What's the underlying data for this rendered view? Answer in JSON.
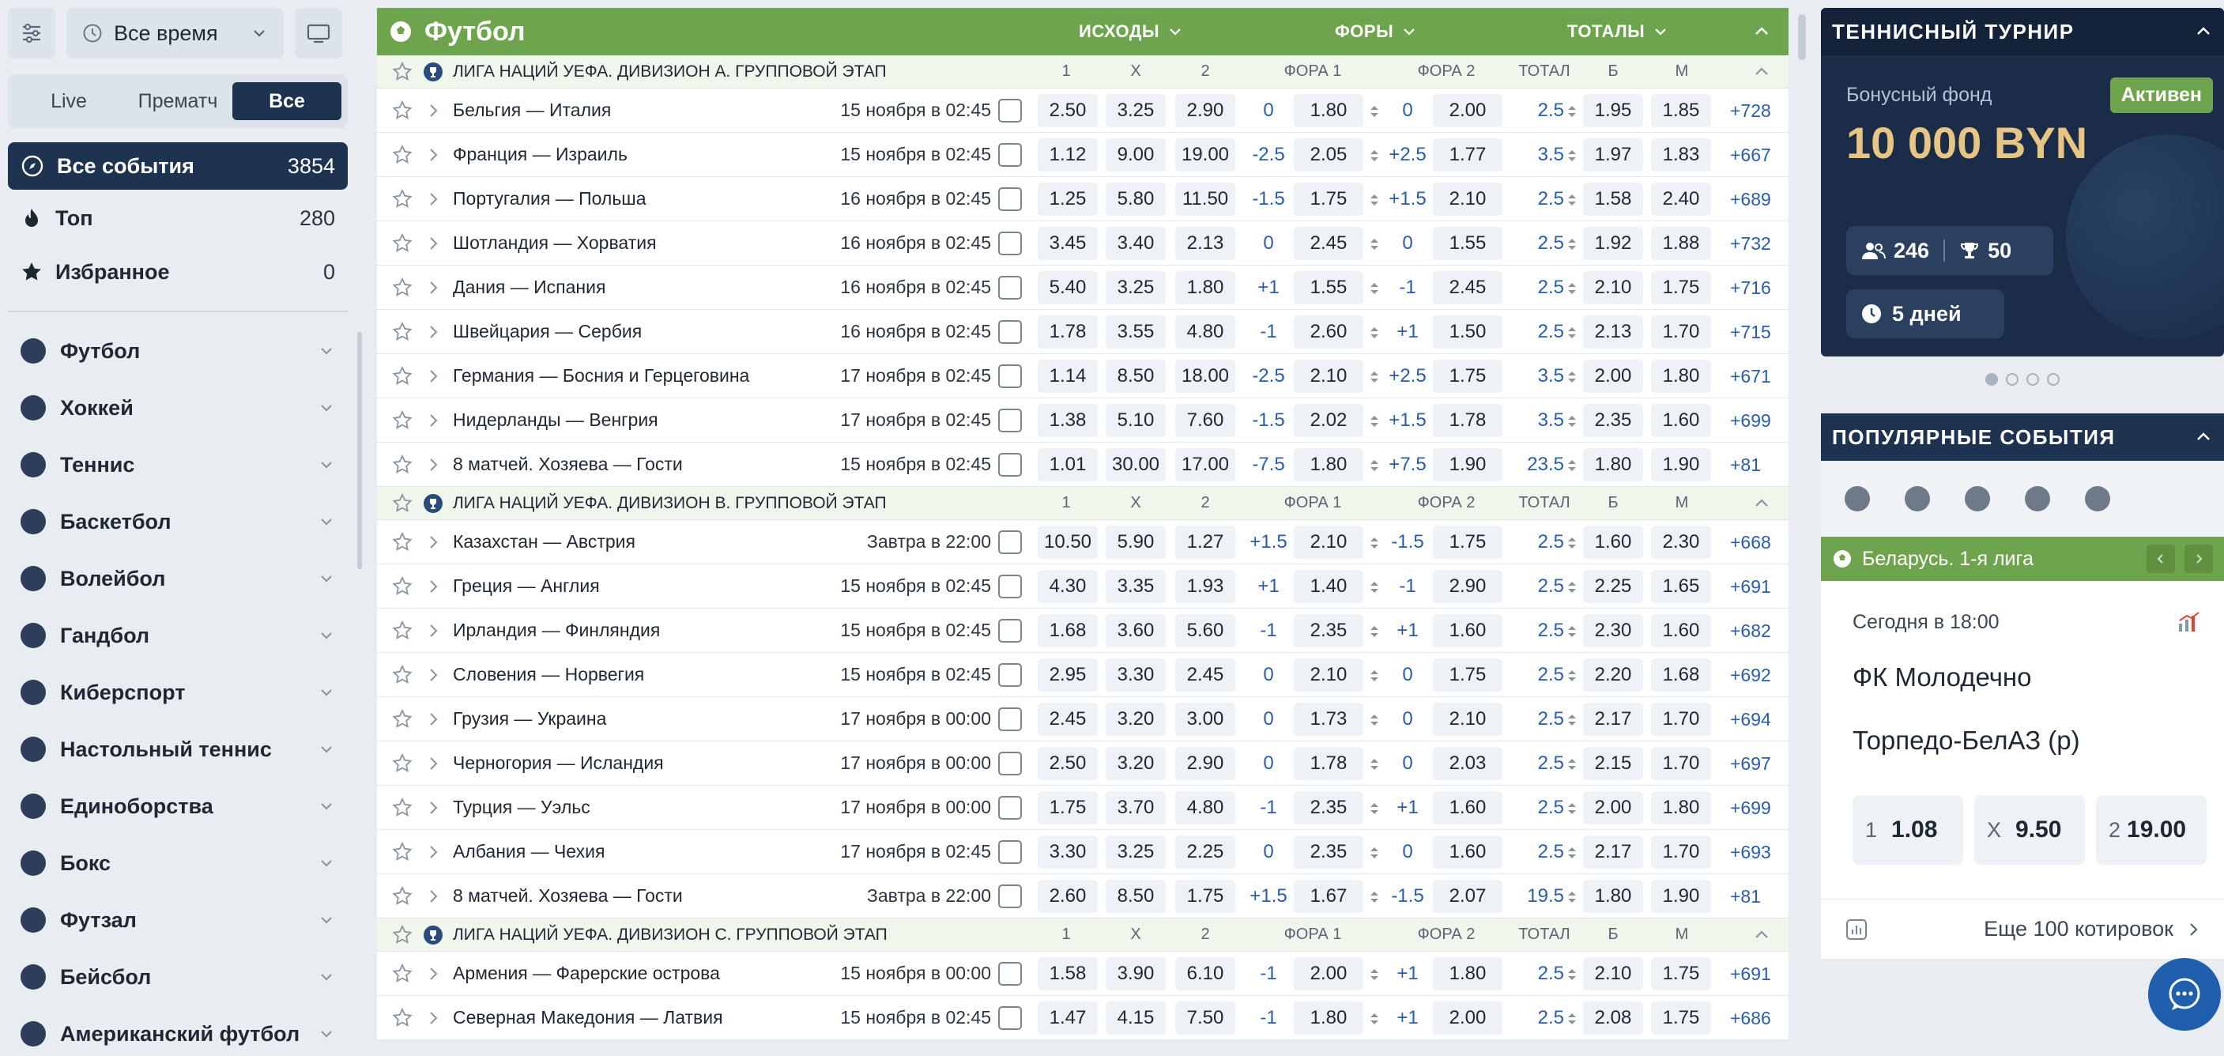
{
  "sidebar": {
    "time_filter": "Все время",
    "tabs": [
      "Live",
      "Прематч",
      "Все"
    ],
    "all_events": {
      "label": "Все события",
      "count": "3854"
    },
    "top": {
      "label": "Топ",
      "count": "280"
    },
    "favorites": {
      "label": "Избранное",
      "count": "0"
    },
    "sports": [
      "Футбол",
      "Хоккей",
      "Теннис",
      "Баскетбол",
      "Волейбол",
      "Гандбол",
      "Киберспорт",
      "Настольный теннис",
      "Единоборства",
      "Бокс",
      "Футзал",
      "Бейсбол",
      "Американский футбол"
    ]
  },
  "main": {
    "sport_title": "Футбол",
    "groups": [
      "ИСХОДЫ",
      "ФОРЫ",
      "ТОТАЛЫ"
    ],
    "columns": [
      "1",
      "X",
      "2",
      "ФОРА 1",
      "ФОРА 2",
      "ТОТАЛ",
      "Б",
      "М"
    ],
    "leagues": [
      {
        "name": "ЛИГА НАЦИЙ УЕФА. ДИВИЗИОН A. ГРУППОВОЙ ЭТАП",
        "events": [
          {
            "name": "Бельгия — Италия",
            "date": "15 ноября в 02:45",
            "o1": "2.50",
            "ox": "3.25",
            "o2": "2.90",
            "h1": "0",
            "h1o": "1.80",
            "h2": "0",
            "h2o": "2.00",
            "t": "2.5",
            "b": "1.95",
            "m": "1.85",
            "more": "+728"
          },
          {
            "name": "Франция — Израиль",
            "date": "15 ноября в 02:45",
            "o1": "1.12",
            "ox": "9.00",
            "o2": "19.00",
            "h1": "-2.5",
            "h1o": "2.05",
            "h2": "+2.5",
            "h2o": "1.77",
            "t": "3.5",
            "b": "1.97",
            "m": "1.83",
            "more": "+667"
          },
          {
            "name": "Португалия — Польша",
            "date": "16 ноября в 02:45",
            "o1": "1.25",
            "ox": "5.80",
            "o2": "11.50",
            "h1": "-1.5",
            "h1o": "1.75",
            "h2": "+1.5",
            "h2o": "2.10",
            "t": "2.5",
            "b": "1.58",
            "m": "2.40",
            "more": "+689"
          },
          {
            "name": "Шотландия — Хорватия",
            "date": "16 ноября в 02:45",
            "o1": "3.45",
            "ox": "3.40",
            "o2": "2.13",
            "h1": "0",
            "h1o": "2.45",
            "h2": "0",
            "h2o": "1.55",
            "t": "2.5",
            "b": "1.92",
            "m": "1.88",
            "more": "+732"
          },
          {
            "name": "Дания — Испания",
            "date": "16 ноября в 02:45",
            "o1": "5.40",
            "ox": "3.25",
            "o2": "1.80",
            "h1": "+1",
            "h1o": "1.55",
            "h2": "-1",
            "h2o": "2.45",
            "t": "2.5",
            "b": "2.10",
            "m": "1.75",
            "more": "+716"
          },
          {
            "name": "Швейцария — Сербия",
            "date": "16 ноября в 02:45",
            "o1": "1.78",
            "ox": "3.55",
            "o2": "4.80",
            "h1": "-1",
            "h1o": "2.60",
            "h2": "+1",
            "h2o": "1.50",
            "t": "2.5",
            "b": "2.13",
            "m": "1.70",
            "more": "+715"
          },
          {
            "name": "Германия — Босния и Герцеговина",
            "date": "17 ноября в 02:45",
            "o1": "1.14",
            "ox": "8.50",
            "o2": "18.00",
            "h1": "-2.5",
            "h1o": "2.10",
            "h2": "+2.5",
            "h2o": "1.75",
            "t": "3.5",
            "b": "2.00",
            "m": "1.80",
            "more": "+671"
          },
          {
            "name": "Нидерланды — Венгрия",
            "date": "17 ноября в 02:45",
            "o1": "1.38",
            "ox": "5.10",
            "o2": "7.60",
            "h1": "-1.5",
            "h1o": "2.02",
            "h2": "+1.5",
            "h2o": "1.78",
            "t": "3.5",
            "b": "2.35",
            "m": "1.60",
            "more": "+699"
          },
          {
            "name": "8 матчей. Хозяева — Гости",
            "date": "15 ноября в 02:45",
            "o1": "1.01",
            "ox": "30.00",
            "o2": "17.00",
            "h1": "-7.5",
            "h1o": "1.80",
            "h2": "+7.5",
            "h2o": "1.90",
            "t": "23.5",
            "b": "1.80",
            "m": "1.90",
            "more": "+81"
          }
        ]
      },
      {
        "name": "ЛИГА НАЦИЙ УЕФА. ДИВИЗИОН B. ГРУППОВОЙ ЭТАП",
        "events": [
          {
            "name": "Казахстан — Австрия",
            "date": "Завтра в 22:00",
            "o1": "10.50",
            "ox": "5.90",
            "o2": "1.27",
            "h1": "+1.5",
            "h1o": "2.10",
            "h2": "-1.5",
            "h2o": "1.75",
            "t": "2.5",
            "b": "1.60",
            "m": "2.30",
            "more": "+668"
          },
          {
            "name": "Греция — Англия",
            "date": "15 ноября в 02:45",
            "o1": "4.30",
            "ox": "3.35",
            "o2": "1.93",
            "h1": "+1",
            "h1o": "1.40",
            "h2": "-1",
            "h2o": "2.90",
            "t": "2.5",
            "b": "2.25",
            "m": "1.65",
            "more": "+691"
          },
          {
            "name": "Ирландия — Финляндия",
            "date": "15 ноября в 02:45",
            "o1": "1.68",
            "ox": "3.60",
            "o2": "5.60",
            "h1": "-1",
            "h1o": "2.35",
            "h2": "+1",
            "h2o": "1.60",
            "t": "2.5",
            "b": "2.30",
            "m": "1.60",
            "more": "+682"
          },
          {
            "name": "Словения — Норвегия",
            "date": "15 ноября в 02:45",
            "o1": "2.95",
            "ox": "3.30",
            "o2": "2.45",
            "h1": "0",
            "h1o": "2.10",
            "h2": "0",
            "h2o": "1.75",
            "t": "2.5",
            "b": "2.20",
            "m": "1.68",
            "more": "+692"
          },
          {
            "name": "Грузия — Украина",
            "date": "17 ноября в 00:00",
            "o1": "2.45",
            "ox": "3.20",
            "o2": "3.00",
            "h1": "0",
            "h1o": "1.73",
            "h2": "0",
            "h2o": "2.10",
            "t": "2.5",
            "b": "2.17",
            "m": "1.70",
            "more": "+694"
          },
          {
            "name": "Черногория — Исландия",
            "date": "17 ноября в 00:00",
            "o1": "2.50",
            "ox": "3.20",
            "o2": "2.90",
            "h1": "0",
            "h1o": "1.78",
            "h2": "0",
            "h2o": "2.03",
            "t": "2.5",
            "b": "2.15",
            "m": "1.70",
            "more": "+697"
          },
          {
            "name": "Турция — Уэльс",
            "date": "17 ноября в 00:00",
            "o1": "1.75",
            "ox": "3.70",
            "o2": "4.80",
            "h1": "-1",
            "h1o": "2.35",
            "h2": "+1",
            "h2o": "1.60",
            "t": "2.5",
            "b": "2.00",
            "m": "1.80",
            "more": "+699"
          },
          {
            "name": "Албания — Чехия",
            "date": "17 ноября в 02:45",
            "o1": "3.30",
            "ox": "3.25",
            "o2": "2.25",
            "h1": "0",
            "h1o": "2.35",
            "h2": "0",
            "h2o": "1.60",
            "t": "2.5",
            "b": "2.17",
            "m": "1.70",
            "more": "+693"
          },
          {
            "name": "8 матчей. Хозяева — Гости",
            "date": "Завтра в 22:00",
            "o1": "2.60",
            "ox": "8.50",
            "o2": "1.75",
            "h1": "+1.5",
            "h1o": "1.67",
            "h2": "-1.5",
            "h2o": "2.07",
            "t": "19.5",
            "b": "1.80",
            "m": "1.90",
            "more": "+81"
          }
        ]
      },
      {
        "name": "ЛИГА НАЦИЙ УЕФА. ДИВИЗИОН C. ГРУППОВОЙ ЭТАП",
        "events": [
          {
            "name": "Армения — Фарерские острова",
            "date": "15 ноября в 00:00",
            "o1": "1.58",
            "ox": "3.90",
            "o2": "6.10",
            "h1": "-1",
            "h1o": "2.00",
            "h2": "+1",
            "h2o": "1.80",
            "t": "2.5",
            "b": "2.10",
            "m": "1.75",
            "more": "+691"
          },
          {
            "name": "Северная Македония — Латвия",
            "date": "15 ноября в 02:45",
            "o1": "1.47",
            "ox": "4.15",
            "o2": "7.50",
            "h1": "-1",
            "h1o": "1.80",
            "h2": "+1",
            "h2o": "2.00",
            "t": "2.5",
            "b": "2.08",
            "m": "1.75",
            "more": "+686"
          }
        ]
      }
    ]
  },
  "promo": {
    "title": "ТЕННИСНЫЙ ТУРНИР",
    "fund_label": "Бонусный фонд",
    "amount": "10 000 BYN",
    "status": "Активен",
    "participants": "246",
    "prizes": "50",
    "duration": "5 дней"
  },
  "popular": {
    "title": "ПОПУЛЯРНЫЕ СОБЫТИЯ",
    "league": "Беларусь. 1-я лига",
    "time": "Сегодня в 18:00",
    "team1": "ФК Молодечно",
    "team2": "Торпедо-БелАЗ (р)",
    "odds": [
      {
        "k": "1",
        "v": "1.08"
      },
      {
        "k": "X",
        "v": "9.50"
      },
      {
        "k": "2",
        "v": "19.00"
      }
    ],
    "more": "Еще 100 котировок"
  },
  "colors": {
    "accent_green": "#6fa44e",
    "navy": "#1e3350",
    "link_blue": "#2a5caa",
    "gold": "#e7c583"
  }
}
